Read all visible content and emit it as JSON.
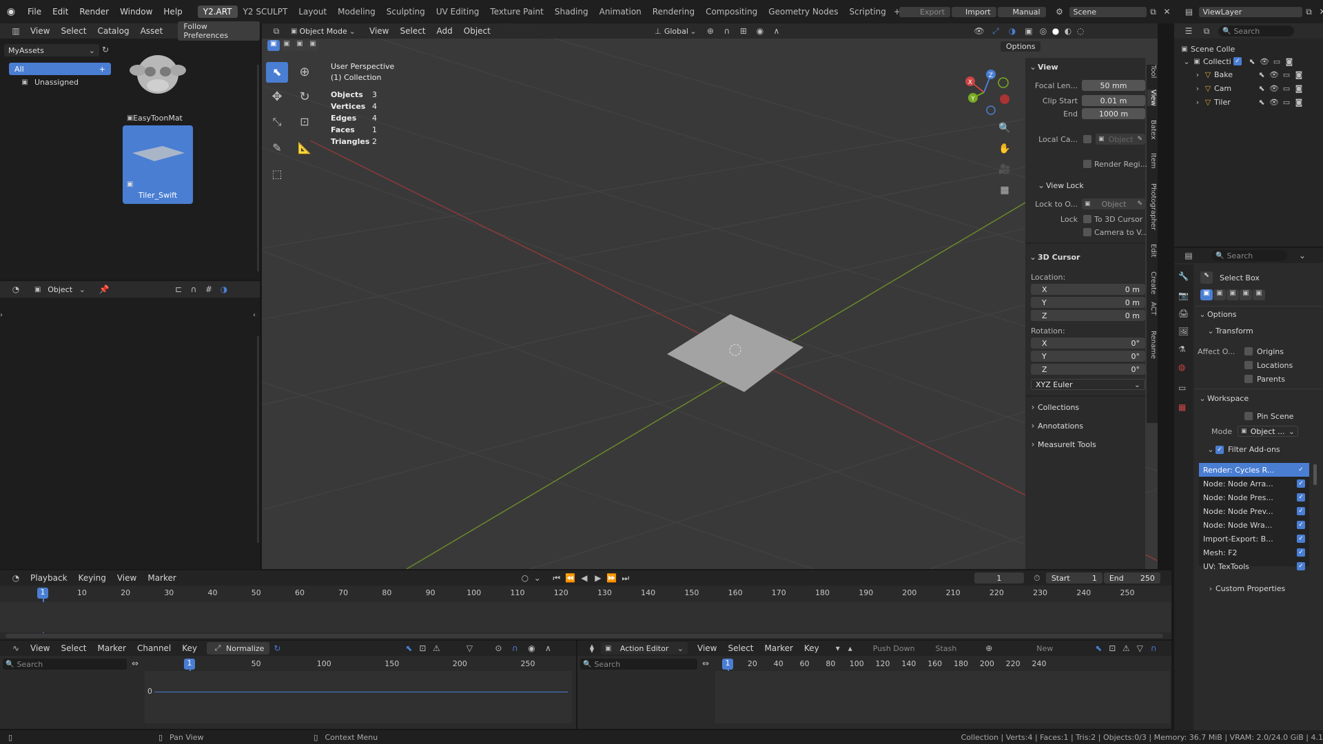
{
  "menu": {
    "items": [
      "File",
      "Edit",
      "Render",
      "Window",
      "Help"
    ]
  },
  "workspaces": [
    "Y2.ART",
    "Y2 SCULPT",
    "Layout",
    "Modeling",
    "Sculpting",
    "UV Editing",
    "Texture Paint",
    "Shading",
    "Animation",
    "Rendering",
    "Compositing",
    "Geometry Nodes",
    "Scripting"
  ],
  "topright": {
    "export": "Export",
    "import": "Import",
    "manual": "Manual",
    "scene": "Scene",
    "viewlayer": "ViewLayer"
  },
  "asset_browser": {
    "menu": [
      "View",
      "Select",
      "Catalog",
      "Asset"
    ],
    "follow": "Follow Preferences",
    "library": "MyAssets",
    "catalog_all": "All",
    "catalog_unassigned": "Unassigned",
    "assets": [
      {
        "name": "EasyToonMat"
      },
      {
        "name": "Tiler_Swift"
      }
    ]
  },
  "left_lower": {
    "mode": "Object"
  },
  "viewport": {
    "mode": "Object Mode",
    "menu": [
      "View",
      "Select",
      "Add",
      "Object"
    ],
    "orientation": "Global",
    "options": "Options",
    "perspective": "User Perspective",
    "collection": "(1) Collection",
    "stats": [
      {
        "k": "Objects",
        "v": "3"
      },
      {
        "k": "Vertices",
        "v": "4"
      },
      {
        "k": "Edges",
        "v": "4"
      },
      {
        "k": "Faces",
        "v": "1"
      },
      {
        "k": "Triangles",
        "v": "2"
      }
    ]
  },
  "npanel": {
    "view_title": "View",
    "focal_label": "Focal Len...",
    "focal": "50 mm",
    "clip_start_label": "Clip Start",
    "clip_start": "0.01 m",
    "end_label": "End",
    "end": "1000 m",
    "local_cam": "Local Ca...",
    "local_obj": "Object",
    "render_region": "Render Regi...",
    "viewlock_title": "View Lock",
    "lock_to": "Lock to O...",
    "lock_obj": "Object",
    "lock": "Lock",
    "to_cursor": "To 3D Cursor",
    "cam_to_view": "Camera to V...",
    "cursor_title": "3D Cursor",
    "location": "Location:",
    "loc": [
      {
        "a": "X",
        "v": "0 m"
      },
      {
        "a": "Y",
        "v": "0 m"
      },
      {
        "a": "Z",
        "v": "0 m"
      }
    ],
    "rotation": "Rotation:",
    "rot": [
      {
        "a": "X",
        "v": "0°"
      },
      {
        "a": "Y",
        "v": "0°"
      },
      {
        "a": "Z",
        "v": "0°"
      }
    ],
    "euler": "XYZ Euler",
    "collections": "Collections",
    "annotations": "Annotations",
    "measureit": "MeasureIt Tools",
    "tabs": [
      "Tool",
      "View",
      "Batex",
      "Item",
      "Photographer",
      "Edit",
      "Create",
      "ACT",
      "Rename"
    ]
  },
  "outliner": {
    "search": "Search",
    "scene": "Scene Colle",
    "collection": "Collecti",
    "items": [
      "Bake",
      "Cam",
      "Tiler"
    ]
  },
  "props": {
    "search": "Search",
    "select_box": "Select Box",
    "options": "Options",
    "transform": "Transform",
    "affect": "Affect O...",
    "origins": "Origins",
    "locations": "Locations",
    "parents": "Parents",
    "workspace": "Workspace",
    "pin_scene": "Pin Scene",
    "mode_label": "Mode",
    "mode_value": "Object ...",
    "filter": "Filter Add-ons",
    "addons": [
      "Render: Cycles R...",
      "Node: Node Arra...",
      "Node: Node Pres...",
      "Node: Node Prev...",
      "Node: Node Wra...",
      "Import-Export: B...",
      "Mesh: F2",
      "UV: TexTools"
    ],
    "custom": "Custom Properties"
  },
  "timeline": {
    "menu": [
      "Playback",
      "Keying",
      "View",
      "Marker"
    ],
    "frame": "1",
    "start_label": "Start",
    "start": "1",
    "end_label": "End",
    "end": "250",
    "ticks": [
      "10",
      "20",
      "30",
      "40",
      "50",
      "60",
      "70",
      "80",
      "90",
      "100",
      "110",
      "120",
      "130",
      "140",
      "150",
      "160",
      "170",
      "180",
      "190",
      "200",
      "210",
      "220",
      "230",
      "240",
      "250"
    ],
    "current": "1"
  },
  "graph": {
    "menu": [
      "View",
      "Select",
      "Marker",
      "Channel",
      "Key"
    ],
    "normalize": "Normalize",
    "search": "Search",
    "ticks": [
      "50",
      "100",
      "150",
      "200",
      "250"
    ],
    "current": "1",
    "zero": "0"
  },
  "action": {
    "editor": "Action Editor",
    "menu": [
      "View",
      "Select",
      "Marker",
      "Key"
    ],
    "push": "Push Down",
    "stash": "Stash",
    "new": "New",
    "search": "Search",
    "ticks": [
      "20",
      "40",
      "60",
      "80",
      "100",
      "120",
      "140",
      "160",
      "180",
      "200",
      "220",
      "240"
    ],
    "current": "1"
  },
  "status": {
    "pan": "Pan View",
    "context": "Context Menu",
    "info": "Collection | Verts:4 | Faces:1 | Tris:2 | Objects:0/3 | Memory: 36.7 MiB | VRAM: 2.0/24.0 GiB | 4.1"
  }
}
